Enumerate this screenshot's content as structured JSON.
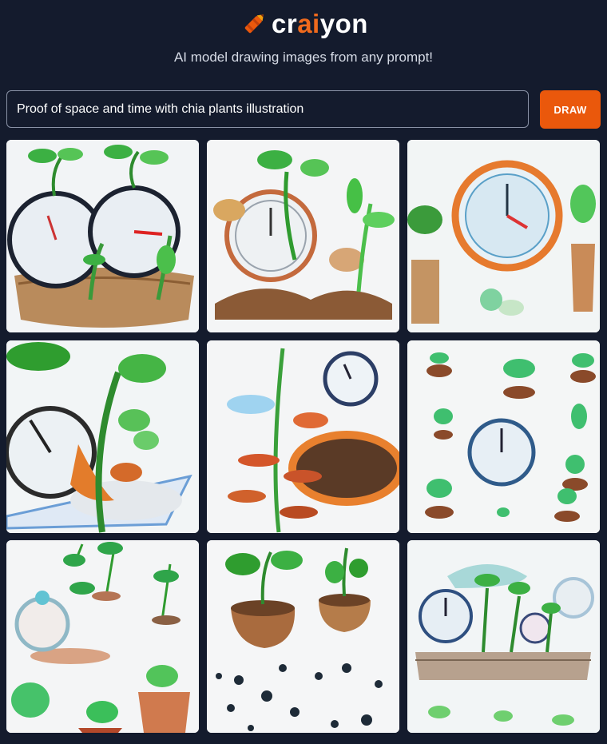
{
  "app": {
    "logo_text_part1": "cr",
    "logo_text_part2": "ai",
    "logo_text_part3": "yon",
    "tagline": "AI model drawing images from any prompt!",
    "brand_color": "#ea580c",
    "background_color": "#141b2d"
  },
  "prompt": {
    "value": "Proof of space and time with chia plants illustration"
  },
  "draw_button": {
    "label": "DRAW"
  },
  "results": {
    "items": [
      {
        "subject": "two clocks with sprouting plants in pots"
      },
      {
        "subject": "clock with seedling and soil mound"
      },
      {
        "subject": "orange ring clock with potted plants"
      },
      {
        "subject": "tall plant growing past broken clock"
      },
      {
        "subject": "plant with red leaves, oval clock and soil"
      },
      {
        "subject": "small clock among sprouting seedlings"
      },
      {
        "subject": "pocket watch with potted seedlings"
      },
      {
        "subject": "two pots with plants and scattered seeds"
      },
      {
        "subject": "clocks above a log with sprouts"
      }
    ]
  }
}
